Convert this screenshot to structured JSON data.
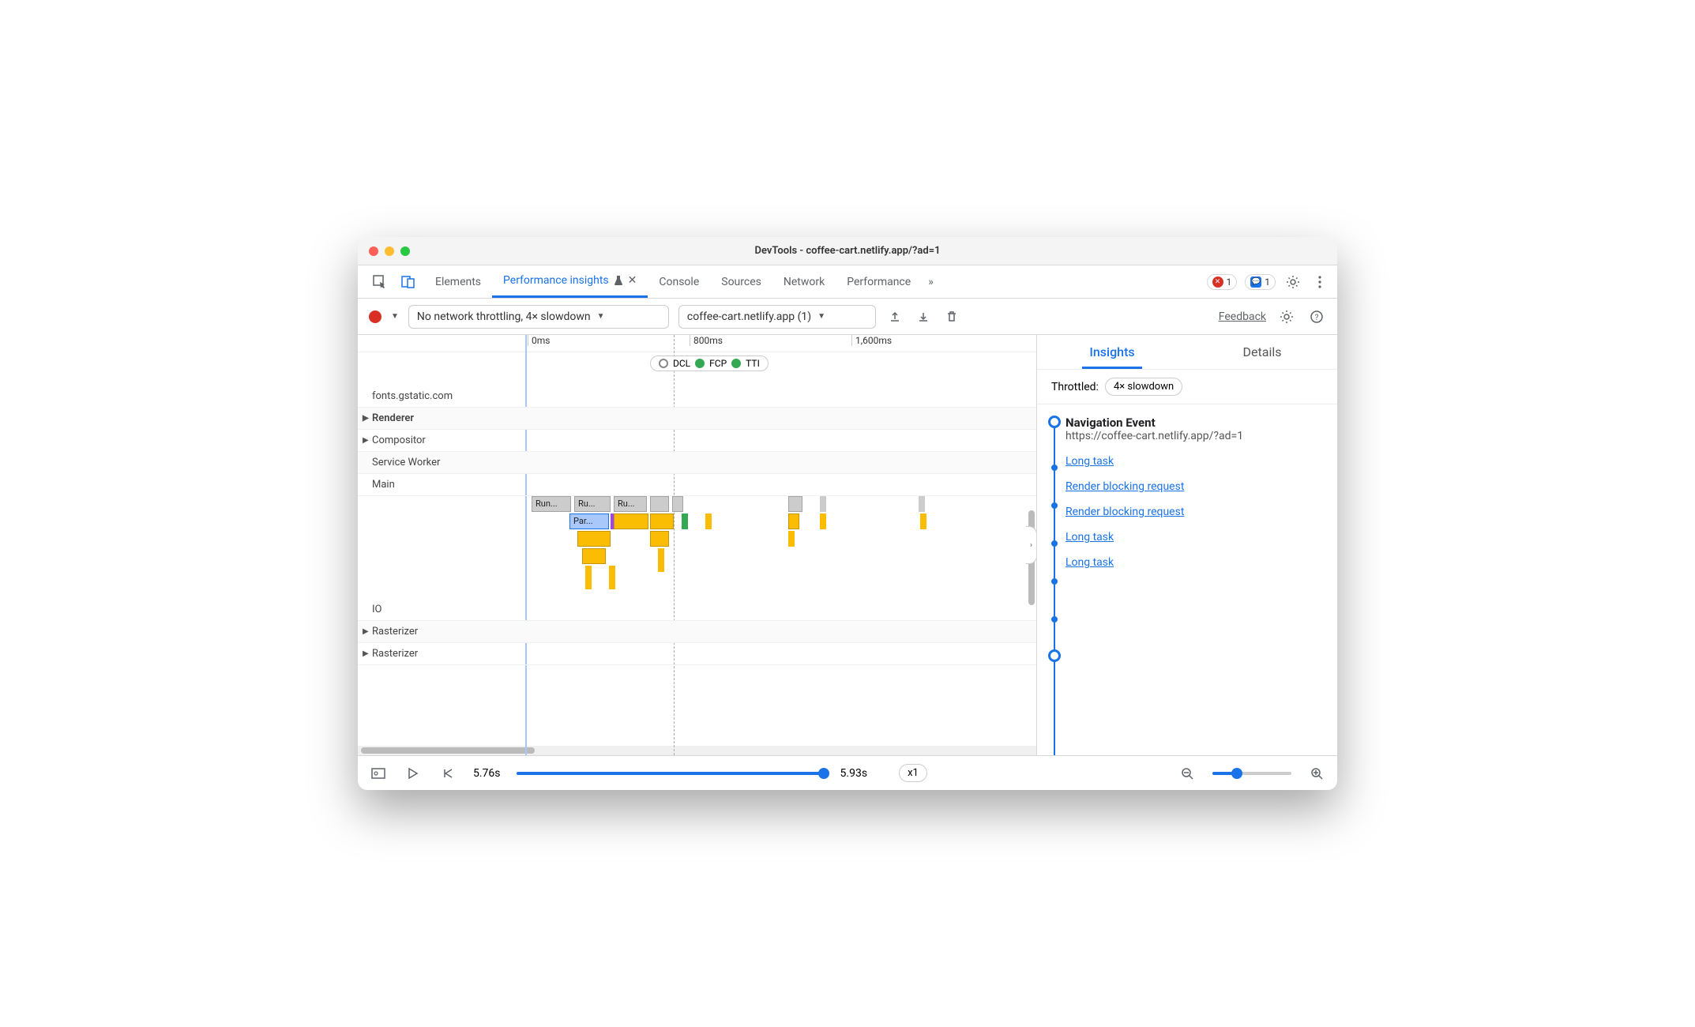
{
  "window_title": "DevTools - coffee-cart.netlify.app/?ad=1",
  "tabs": {
    "items": [
      "Elements",
      "Performance insights",
      "Console",
      "Sources",
      "Network",
      "Performance"
    ],
    "active": "Performance insights",
    "more_glyph": "»"
  },
  "badges": {
    "errors": "1",
    "messages": "1"
  },
  "toolbar": {
    "throttle": "No network throttling, 4× slowdown",
    "target": "coffee-cart.netlify.app (1)",
    "feedback": "Feedback"
  },
  "ruler": {
    "t0": "0ms",
    "t1": "800ms",
    "t2": "1,600ms"
  },
  "markers": {
    "dcl": "DCL",
    "fcp": "FCP",
    "tti": "TTI"
  },
  "tracks": {
    "fonts": "fonts.gstatic.com",
    "renderer": "Renderer",
    "compositor": "Compositor",
    "service_worker": "Service Worker",
    "main": "Main",
    "io": "IO",
    "rasterizer1": "Rasterizer",
    "rasterizer2": "Rasterizer"
  },
  "flame": {
    "run": "Run...",
    "ru1": "Ru...",
    "ru2": "Ru...",
    "par": "Par..."
  },
  "insights": {
    "tab_insights": "Insights",
    "tab_details": "Details",
    "throttled_label": "Throttled:",
    "throttled_value": "4× slowdown",
    "nav_event": "Navigation Event",
    "nav_url": "https://coffee-cart.netlify.app/?ad=1",
    "items": [
      "Long task",
      "Render blocking request",
      "Render blocking request",
      "Long task",
      "Long task"
    ]
  },
  "footer": {
    "time_left": "5.76s",
    "time_right": "5.93s",
    "zoom": "x1"
  }
}
